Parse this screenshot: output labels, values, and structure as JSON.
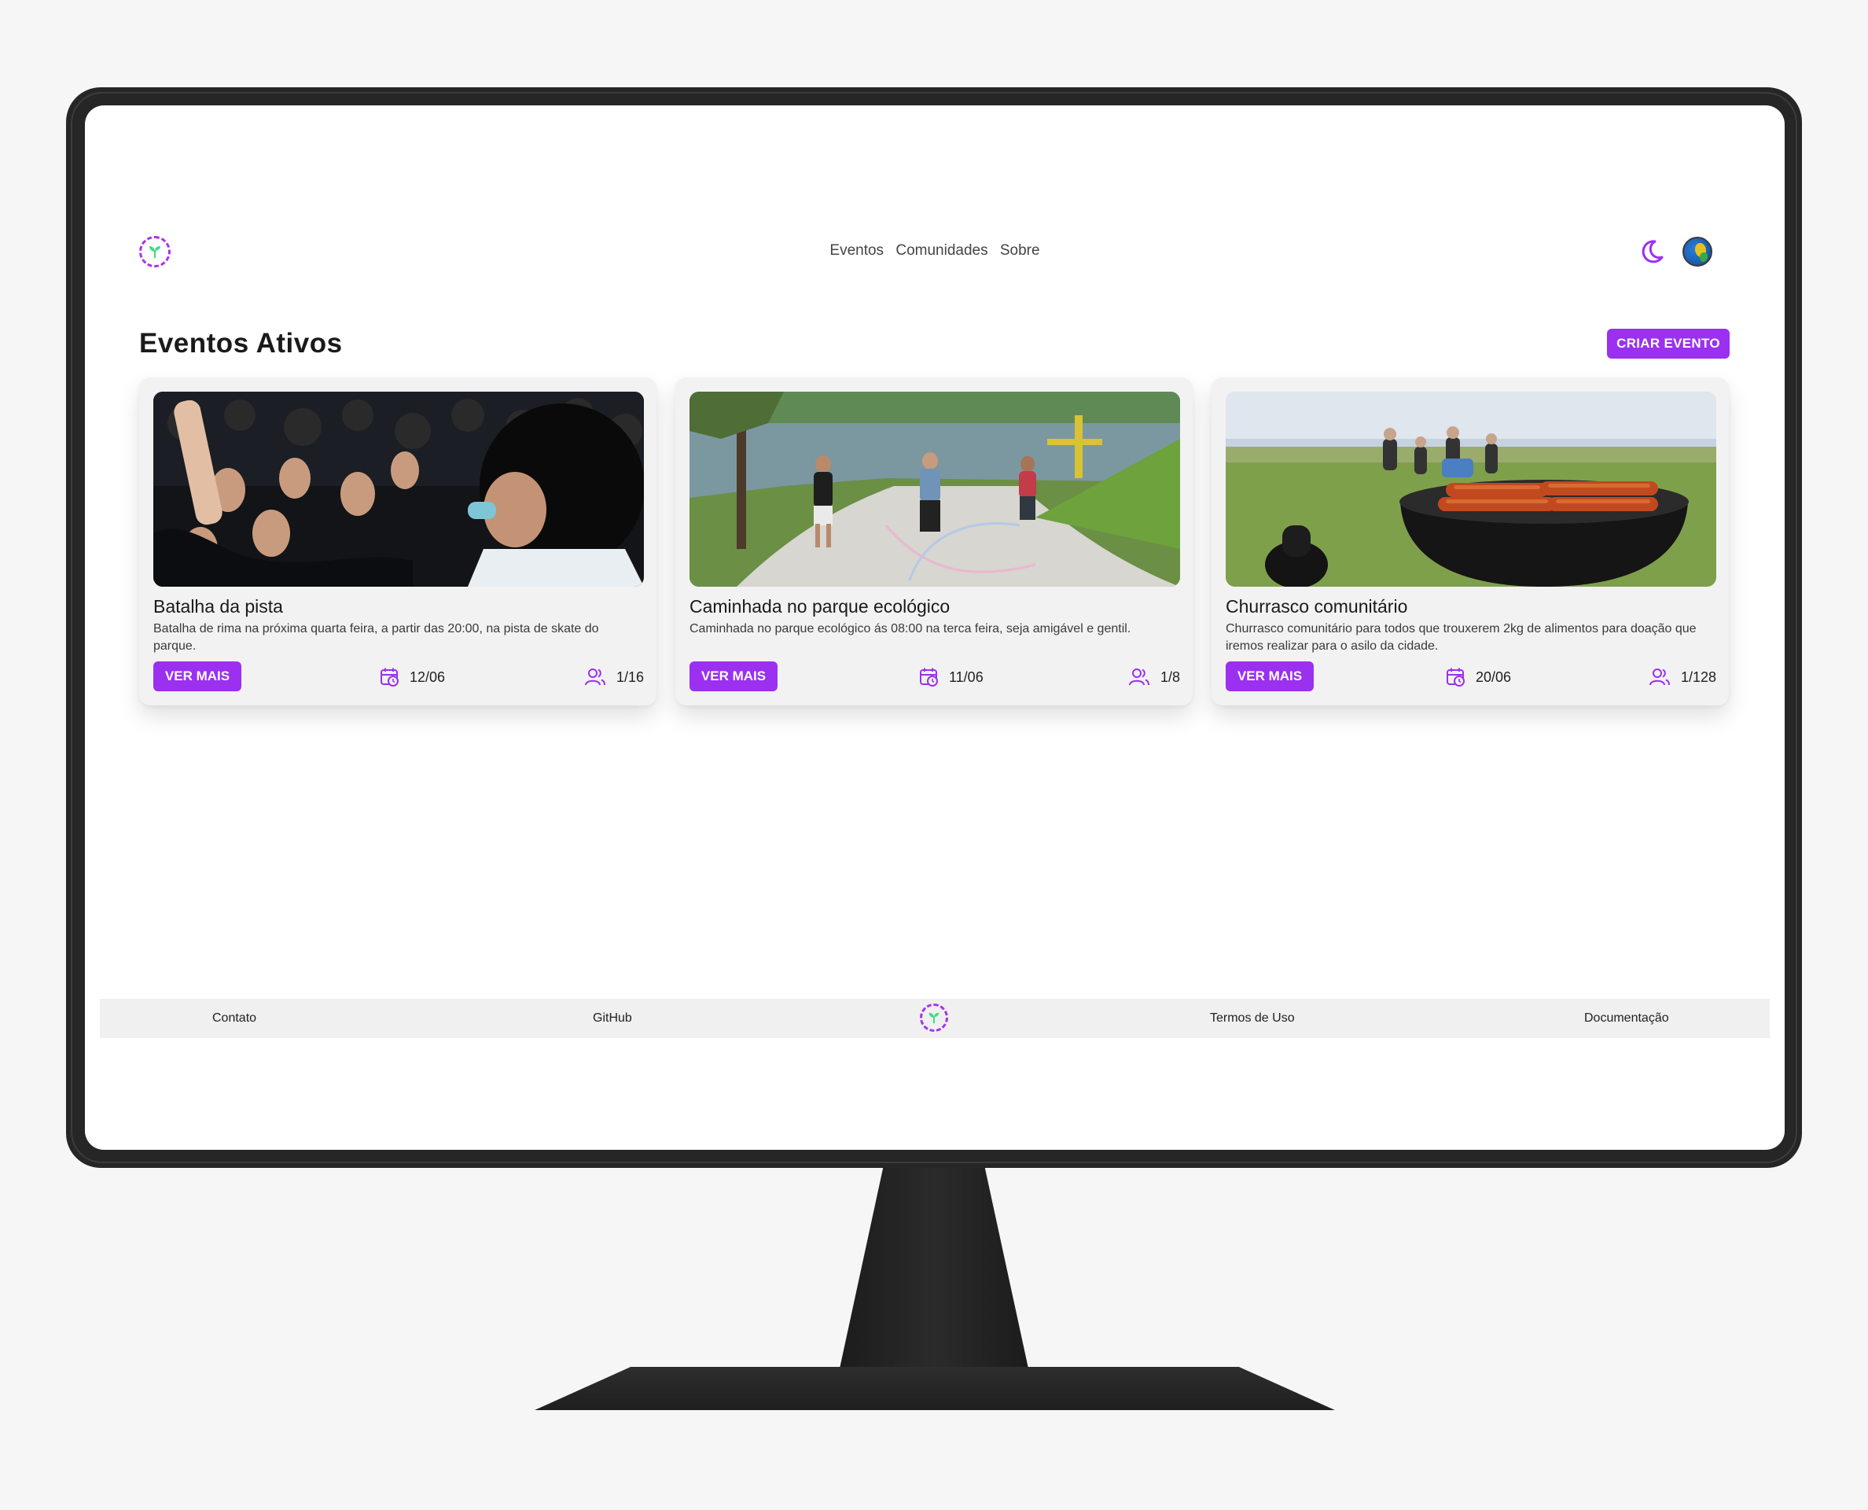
{
  "header": {
    "nav": [
      "Eventos",
      "Comunidades",
      "Sobre"
    ],
    "theme_toggle_icon": "moon-icon",
    "language_icon": "globe-icon"
  },
  "main": {
    "title": "Eventos Ativos",
    "create_button": "CRIAR EVENTO",
    "events": [
      {
        "title": "Batalha da pista",
        "description": "Batalha de rima na próxima quarta feira, a partir das 20:00, na pista de skate do parque.",
        "button": "VER MAIS",
        "date": "12/06",
        "participants": "1/16"
      },
      {
        "title": "Caminhada no parque ecológico",
        "description": "Caminhada no parque ecológico ás 08:00 na terca feira, seja amigável e gentil.",
        "button": "VER MAIS",
        "date": "11/06",
        "participants": "1/8"
      },
      {
        "title": "Churrasco comunitário",
        "description": "Churrasco comunitário para todos que trouxerem 2kg de alimentos para doação que iremos realizar para o asilo da cidade.",
        "button": "VER MAIS",
        "date": "20/06",
        "participants": "1/128"
      }
    ]
  },
  "footer": {
    "links": [
      "Contato",
      "GitHub",
      "Termos de Uso",
      "Documentação"
    ]
  },
  "colors": {
    "accent": "#9b30f0",
    "logo_leaf": "#3ddc84",
    "bezel": "#262626"
  }
}
